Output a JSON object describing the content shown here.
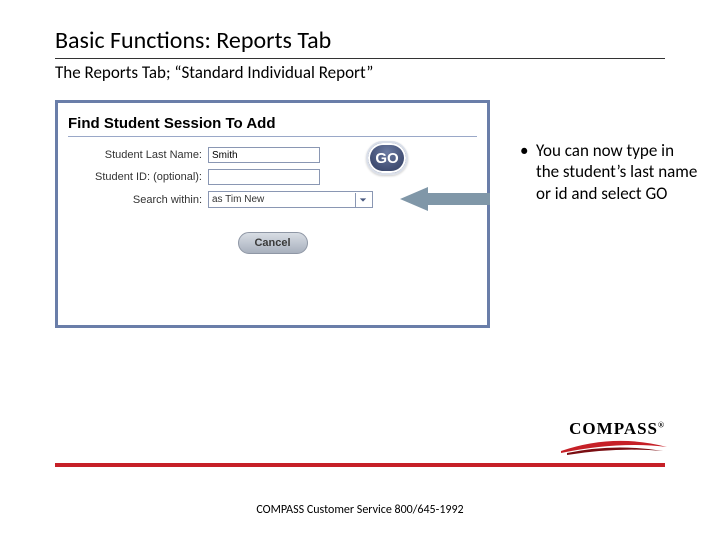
{
  "title": "Basic Functions: Reports Tab",
  "subtitle": "The Reports Tab; “Standard Individual Report”",
  "panel": {
    "heading": "Find Student Session To Add",
    "rows": {
      "lastname_label": "Student Last Name:",
      "lastname_value": "Smith",
      "id_label": "Student ID: (optional):",
      "id_value": "",
      "search_label": "Search within:",
      "search_value": "as Tim New"
    },
    "go_label": "GO",
    "cancel_label": "Cancel"
  },
  "bullets": [
    "You can now type in the student’s last name or id and select GO"
  ],
  "logo": {
    "text": "COMPASS",
    "reg": "®"
  },
  "footer": "COMPASS Customer Service 800/645-1992",
  "colors": {
    "accent_red": "#c62027",
    "panel_border": "#6a7ea9",
    "go_dark": "#404d72"
  }
}
